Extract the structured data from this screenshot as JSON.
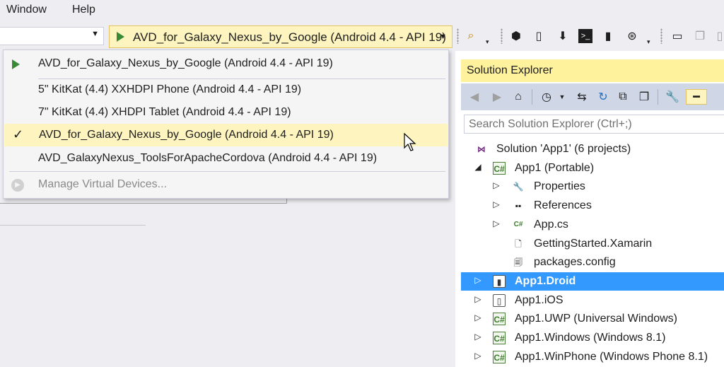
{
  "menubar": {
    "items": [
      "Window",
      "Help"
    ]
  },
  "toolbar": {
    "config_value": "",
    "run_target": "AVD_for_Galaxy_Nexus_by_Google (Android 4.4 - API 19)",
    "icons": [
      "find-in-files-icon",
      "start-icon",
      "device-log-icon",
      "android-sdk-icon",
      "terminal-icon",
      "device-icon",
      "xamarin-icon",
      "screen-icon",
      "copy-icon"
    ]
  },
  "dropdown": {
    "items": [
      {
        "label": "AVD_for_Galaxy_Nexus_by_Google (Android 4.4 - API 19)",
        "marker": "play"
      },
      {
        "label": "5\" KitKat (4.4) XXHDPI Phone (Android 4.4 - API 19)",
        "marker": ""
      },
      {
        "label": "7\" KitKat (4.4) XHDPI Tablet (Android 4.4 - API 19)",
        "marker": ""
      },
      {
        "label": "AVD_for_Galaxy_Nexus_by_Google (Android 4.4 - API 19)",
        "marker": "check"
      },
      {
        "label": "AVD_GalaxyNexus_ToolsForApacheCordova (Android 4.4 - API 19)",
        "marker": ""
      }
    ],
    "manage_label": "Manage Virtual Devices..."
  },
  "solution_explorer": {
    "title": "Solution Explorer",
    "search_placeholder": "Search Solution Explorer (Ctrl+;)",
    "tree": [
      {
        "label": "Solution 'App1' (6 projects)",
        "icon": "solution-icon",
        "level": 0,
        "expander": ""
      },
      {
        "label": "App1 (Portable)",
        "icon": "csharp-project-icon",
        "level": 1,
        "expander": "expanded"
      },
      {
        "label": "Properties",
        "icon": "wrench-icon",
        "level": 2,
        "expander": "collapsed"
      },
      {
        "label": "References",
        "icon": "references-icon",
        "level": 2,
        "expander": "collapsed"
      },
      {
        "label": "App.cs",
        "icon": "csharp-file-icon",
        "level": 2,
        "expander": "collapsed"
      },
      {
        "label": "GettingStarted.Xamarin",
        "icon": "file-icon",
        "level": 2,
        "expander": ""
      },
      {
        "label": "packages.config",
        "icon": "config-file-icon",
        "level": 2,
        "expander": ""
      },
      {
        "label": "App1.Droid",
        "icon": "android-project-icon",
        "level": 1,
        "expander": "collapsed",
        "selected": true
      },
      {
        "label": "App1.iOS",
        "icon": "ios-project-icon",
        "level": 1,
        "expander": "collapsed"
      },
      {
        "label": "App1.UWP (Universal Windows)",
        "icon": "csharp-project-icon",
        "level": 1,
        "expander": "collapsed"
      },
      {
        "label": "App1.Windows (Windows 8.1)",
        "icon": "csharp-project-icon",
        "level": 1,
        "expander": "collapsed"
      },
      {
        "label": "App1.WinPhone (Windows Phone 8.1)",
        "icon": "csharp-project-icon",
        "level": 1,
        "expander": "collapsed"
      }
    ]
  },
  "colors": {
    "accent_yellow": "#fdf4bf",
    "title_yellow": "#fff29d",
    "selection_blue": "#3399ff",
    "play_green": "#388a34"
  }
}
